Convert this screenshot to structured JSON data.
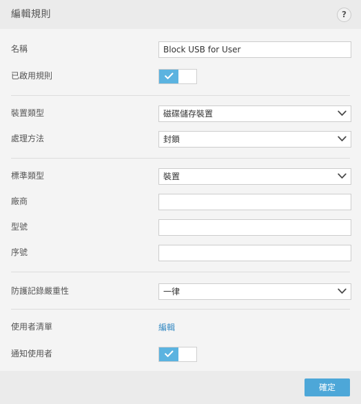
{
  "header": {
    "title": "編輯規則",
    "help_icon": "question-mark-icon",
    "help_label": "?"
  },
  "form": {
    "name": {
      "label": "名稱",
      "value": "Block USB for User",
      "placeholder": ""
    },
    "rule_enabled": {
      "label": "已啟用規則",
      "state": "on",
      "icon": "check-icon"
    },
    "device_type": {
      "label": "裝置類型",
      "value": "磁碟儲存裝置"
    },
    "action": {
      "label": "處理方法",
      "value": "封鎖"
    },
    "criteria_type": {
      "label": "標準類型",
      "value": "裝置"
    },
    "vendor": {
      "label": "廠商",
      "value": "",
      "placeholder": ""
    },
    "model": {
      "label": "型號",
      "value": "",
      "placeholder": ""
    },
    "serial_number": {
      "label": "序號",
      "value": "",
      "placeholder": ""
    },
    "log_severity": {
      "label": "防護記錄嚴重性",
      "value": "一律"
    },
    "user_list": {
      "label": "使用者清單",
      "edit_link": "編輯"
    },
    "notify_user": {
      "label": "通知使用者",
      "state": "on",
      "icon": "check-icon"
    }
  },
  "footer": {
    "ok_label": "確定"
  },
  "colors": {
    "accent": "#4da7d8",
    "toggle_on": "#5bb3e0",
    "link": "#3b8dc4",
    "header_bg": "#ebebeb",
    "body_bg": "#f4f4f4",
    "divider": "#dcdcdc"
  }
}
